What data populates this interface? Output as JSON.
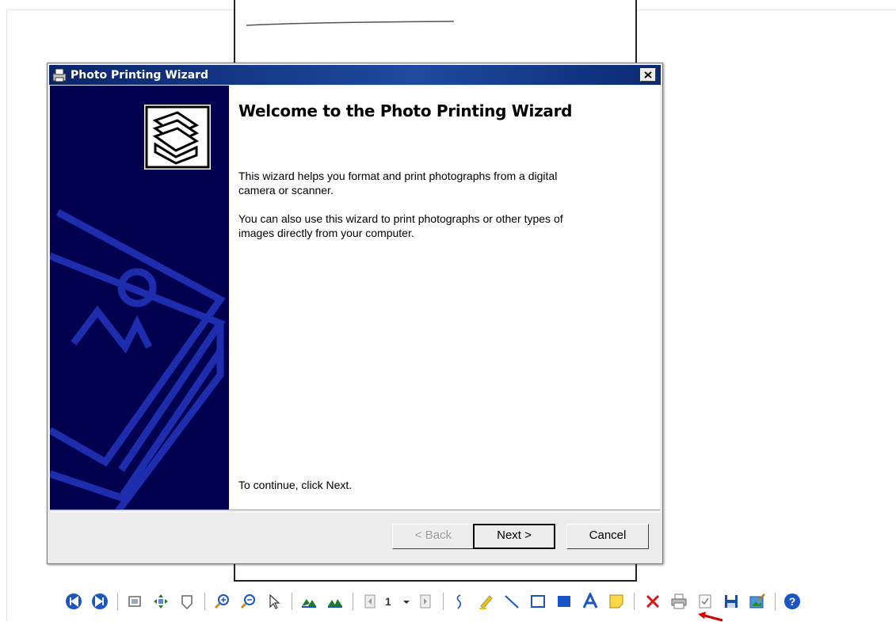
{
  "dialog": {
    "title": "Photo Printing Wizard",
    "heading": "Welcome to the Photo Printing Wizard",
    "paragraph1": "This wizard helps you format and print photographs from a digital camera or scanner.",
    "paragraph2": "You can also use this wizard to print photographs or other types of images directly from your computer.",
    "continue_text": "To continue, click Next.",
    "buttons": {
      "back": "< Back",
      "next": "Next >",
      "cancel": "Cancel"
    }
  },
  "toolbar": {
    "page_number": "1",
    "tools": [
      "previous-page-icon",
      "next-page-icon",
      "fit-page-icon",
      "pan-icon",
      "fit-width-icon",
      "zoom-in-icon",
      "zoom-out-icon",
      "select-pointer-icon",
      "rotate-left-icon",
      "rotate-right-icon",
      "page-back-icon",
      "page-dropdown-icon",
      "page-forward-icon",
      "freehand-pen-icon",
      "highlighter-icon",
      "line-icon",
      "rectangle-icon",
      "filled-rectangle-icon",
      "text-icon",
      "sticky-note-icon",
      "delete-icon",
      "print-icon",
      "checkbox-icon",
      "save-icon",
      "image-edit-icon",
      "help-icon"
    ]
  },
  "colors": {
    "titlebar": "#0a246a",
    "wizard_side": "#00004f",
    "toolbar_blue": "#1a55c5",
    "delete_red": "#d11a1a",
    "arrow_red": "#d40000"
  }
}
